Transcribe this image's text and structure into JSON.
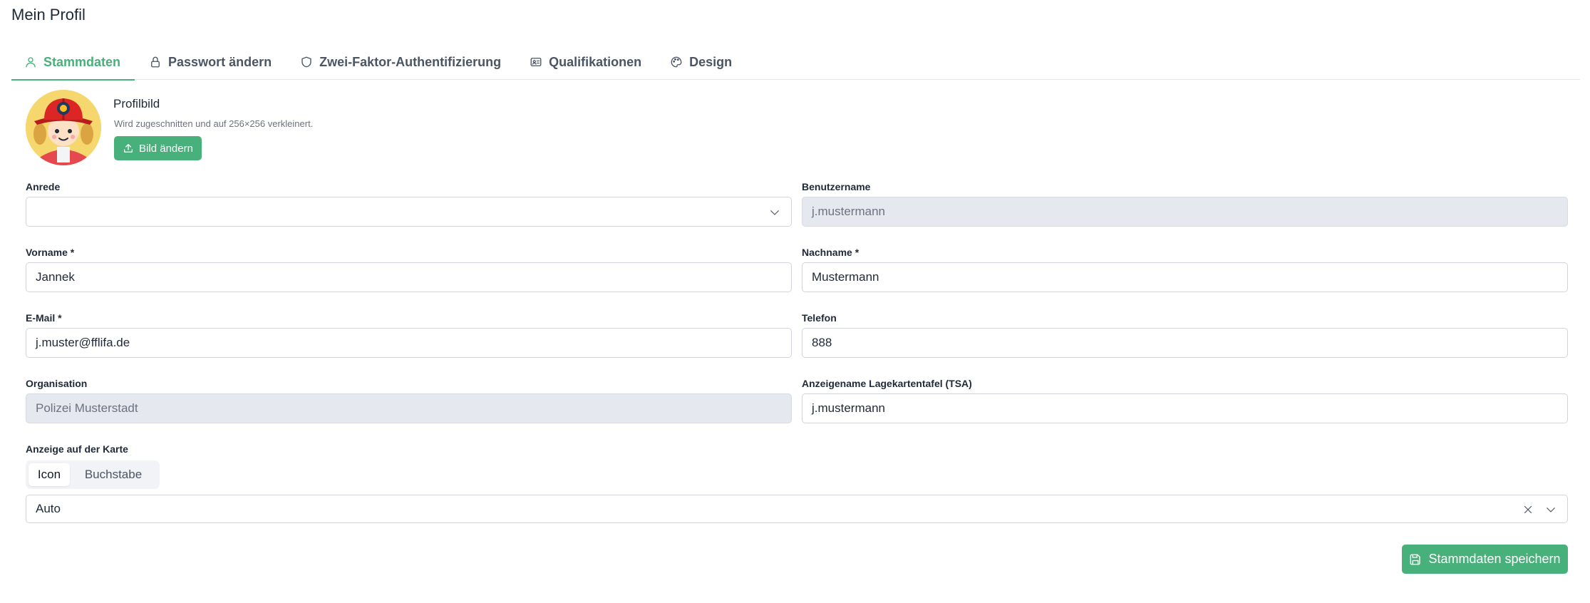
{
  "page": {
    "title": "Mein Profil"
  },
  "tabs": [
    {
      "label": "Stammdaten",
      "icon": "user-icon",
      "active": true
    },
    {
      "label": "Passwort ändern",
      "icon": "lock-icon",
      "active": false
    },
    {
      "label": "Zwei-Faktor-Authentifizierung",
      "icon": "shield-icon",
      "active": false
    },
    {
      "label": "Qualifikationen",
      "icon": "id-card-icon",
      "active": false
    },
    {
      "label": "Design",
      "icon": "palette-icon",
      "active": false
    }
  ],
  "profile": {
    "title": "Profilbild",
    "subtitle": "Wird zugeschnitten und auf 256×256 verkleinert.",
    "upload_label": "Bild ändern",
    "avatar_icon": "firefighter-avatar"
  },
  "form": {
    "anrede": {
      "label": "Anrede",
      "value": ""
    },
    "benutzername": {
      "label": "Benutzername",
      "value": "j.mustermann"
    },
    "vorname": {
      "label": "Vorname *",
      "value": "Jannek"
    },
    "nachname": {
      "label": "Nachname *",
      "value": "Mustermann"
    },
    "email": {
      "label": "E-Mail *",
      "value": "j.muster@fflifa.de"
    },
    "telefon": {
      "label": "Telefon",
      "value": "888"
    },
    "organisation": {
      "label": "Organisation",
      "value": "Polizei Musterstadt"
    },
    "tsa": {
      "label": "Anzeigename Lagekartentafel (TSA)",
      "value": "j.mustermann"
    },
    "karte": {
      "label": "Anzeige auf der Karte",
      "options": [
        "Icon",
        "Buchstabe"
      ],
      "selected": "Icon",
      "select_value": "Auto"
    }
  },
  "actions": {
    "save_label": "Stammdaten speichern"
  },
  "colors": {
    "accent": "#48b07a",
    "disabled_bg": "#e5e8ef",
    "border": "#d1d5db"
  }
}
